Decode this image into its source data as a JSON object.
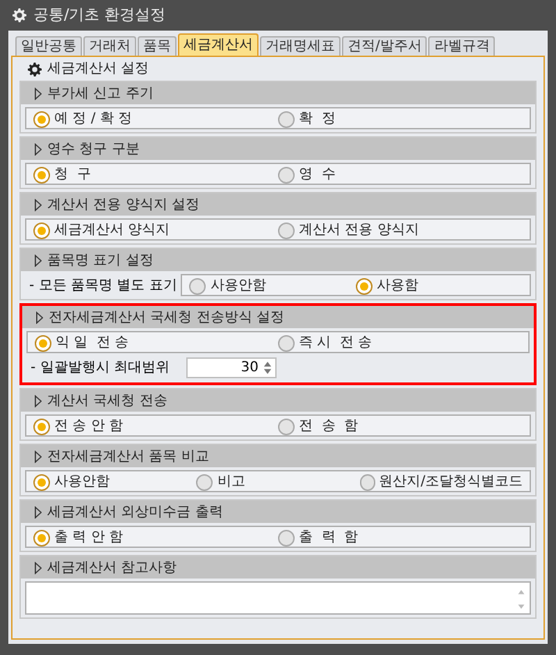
{
  "window": {
    "title": "공통/기초 환경설정"
  },
  "tabs": [
    {
      "label": "일반공통",
      "selected": false
    },
    {
      "label": "거래처",
      "selected": false
    },
    {
      "label": "품목",
      "selected": false
    },
    {
      "label": "세금계산서",
      "selected": true
    },
    {
      "label": "거래명세표",
      "selected": false
    },
    {
      "label": "견적/발주서",
      "selected": false
    },
    {
      "label": "라벨규격",
      "selected": false
    }
  ],
  "panel_title": "세금계산서 설정",
  "sections": [
    {
      "title": "부가세 신고 주기",
      "highlighted": false,
      "rows": [
        {
          "kind": "radios",
          "options": [
            {
              "label": "예 정 / 확 정",
              "selected": true
            },
            {
              "label": "확  정",
              "selected": false
            }
          ]
        }
      ]
    },
    {
      "title": "영수 청구 구분",
      "highlighted": false,
      "rows": [
        {
          "kind": "radios",
          "options": [
            {
              "label": "청  구",
              "selected": true
            },
            {
              "label": "영  수",
              "selected": false
            }
          ]
        }
      ]
    },
    {
      "title": "계산서 전용 양식지 설정",
      "highlighted": false,
      "rows": [
        {
          "kind": "radios",
          "options": [
            {
              "label": "세금계산서 양식지",
              "selected": true
            },
            {
              "label": "계산서 전용 양식지",
              "selected": false
            }
          ]
        }
      ]
    },
    {
      "title": "품목명 표기 설정",
      "highlighted": false,
      "rows": [
        {
          "kind": "labeled-radios",
          "label": "- 모든 품목명 별도 표기",
          "options": [
            {
              "label": "사용안함",
              "selected": false
            },
            {
              "label": "사용함",
              "selected": true
            }
          ]
        }
      ]
    },
    {
      "title": "전자세금계산서 국세청 전송방식 설정",
      "highlighted": true,
      "rows": [
        {
          "kind": "radios",
          "options": [
            {
              "label": "익 일  전 송",
              "selected": true
            },
            {
              "label": "즉 시  전 송",
              "selected": false
            }
          ]
        },
        {
          "kind": "spinner",
          "label": "- 일괄발행시 최대범위",
          "value": "30"
        }
      ]
    },
    {
      "title": "계산서 국세청 전송",
      "highlighted": false,
      "rows": [
        {
          "kind": "radios",
          "options": [
            {
              "label": "전 송 안 함",
              "selected": true
            },
            {
              "label": "전  송  함",
              "selected": false
            }
          ]
        }
      ]
    },
    {
      "title": "전자세금계산서 품목 비교",
      "highlighted": false,
      "rows": [
        {
          "kind": "radios",
          "options": [
            {
              "label": "사용안함",
              "selected": true
            },
            {
              "label": "비고",
              "selected": false
            },
            {
              "label": "원산지/조달청식별코드",
              "selected": false
            }
          ]
        }
      ]
    },
    {
      "title": "세금계산서 외상미수금 출력",
      "highlighted": false,
      "rows": [
        {
          "kind": "radios",
          "options": [
            {
              "label": "출 력 안 함",
              "selected": true
            },
            {
              "label": "출  력  함",
              "selected": false
            }
          ]
        }
      ]
    },
    {
      "title": "세금계산서 참고사항",
      "highlighted": false,
      "rows": [
        {
          "kind": "textarea"
        }
      ]
    }
  ]
}
